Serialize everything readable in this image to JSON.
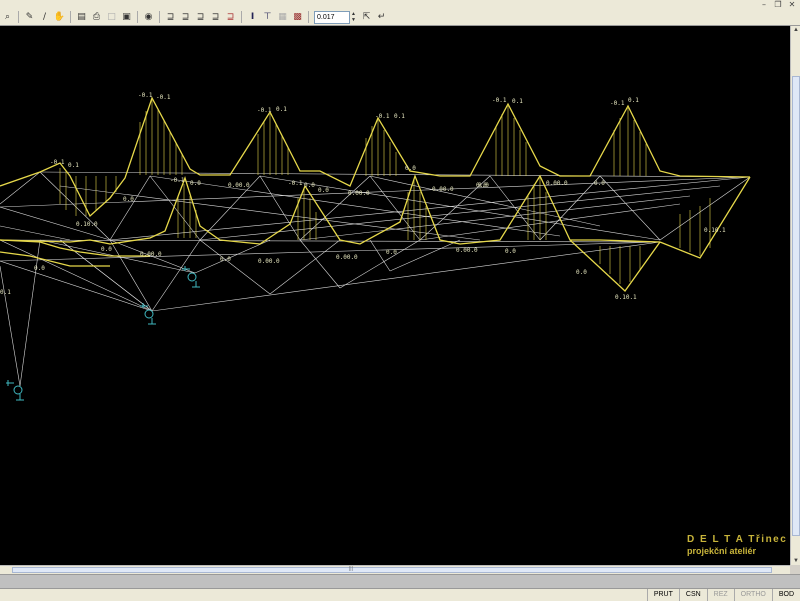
{
  "window": {
    "controls": [
      "–",
      "❐",
      "✕"
    ]
  },
  "toolbar": {
    "zoom_value": "0.017",
    "buttons": [
      "zoom-icon",
      "pencil-icon",
      "line-icon",
      "hand-icon",
      "print-icon",
      "printer-icon",
      "page-icon",
      "layers-icon",
      "view-icon",
      "section-1-icon",
      "section-2-icon",
      "section-3-icon",
      "section-4-icon",
      "section-5-icon",
      "beam-i-icon",
      "beam-t-icon",
      "grid-icon",
      "hatch-icon",
      "scale-icon",
      "pointer-icon"
    ]
  },
  "statusbar": {
    "cells": [
      {
        "label": "PRUT",
        "dim": false
      },
      {
        "label": "CSN",
        "dim": false
      },
      {
        "label": "REZ",
        "dim": true
      },
      {
        "label": "ORTHO",
        "dim": true
      },
      {
        "label": "BOD",
        "dim": false
      }
    ]
  },
  "brand": {
    "line1": "D E L T A  Třinec",
    "line2": "projekční ateliér"
  },
  "colors": {
    "canvas": "#000000",
    "members": "#d8d8d8",
    "diagram": "#e6d84a",
    "supports": "#3fb8c0",
    "brand": "#c8b43a"
  },
  "diagram_labels": {
    "peak_1": "-0.1",
    "peak_1b": "-0.1",
    "peak_2": "-0.1",
    "peak_2b": "0.1",
    "peak_3": "-0.1",
    "peak_3b": "0.1",
    "peak_4": "-0.1",
    "peak_4b": "0.1",
    "peak_5": "-0.1",
    "peak_5b": "0.1",
    "left_top": "-0.1",
    "left_top_b": "0.1",
    "mid_1": "-0.1",
    "mid_1b": "0.0",
    "mid_2": "-0.1",
    "mid_2b": "0.0",
    "mid_3": "0.0",
    "upper_val_1": "0.00.0",
    "upper_val_2": "0.00.0",
    "upper_val_3": "0.00.0",
    "upper_val_4": "0.0",
    "upper_val_5": "0.00.0",
    "upper_val_6": "0.0",
    "upper_val_7": "0.0",
    "left_mid": "0.10.0",
    "lower_val_1": "0.0",
    "lower_val_2": "0.00.0",
    "lower_val_3": "0.0",
    "lower_val_4": "0.00.0",
    "lower_val_5": "0.0",
    "lower_val_6": "0.00.0",
    "lower_val_7": "0.0",
    "lower_val_8": "0.0",
    "right_1": "0.10.1",
    "right_2": "0.10.1",
    "right_3": "0.0",
    "left_edge_1": "0.0",
    "left_edge_2": "0.1",
    "x_0": "0.0"
  }
}
